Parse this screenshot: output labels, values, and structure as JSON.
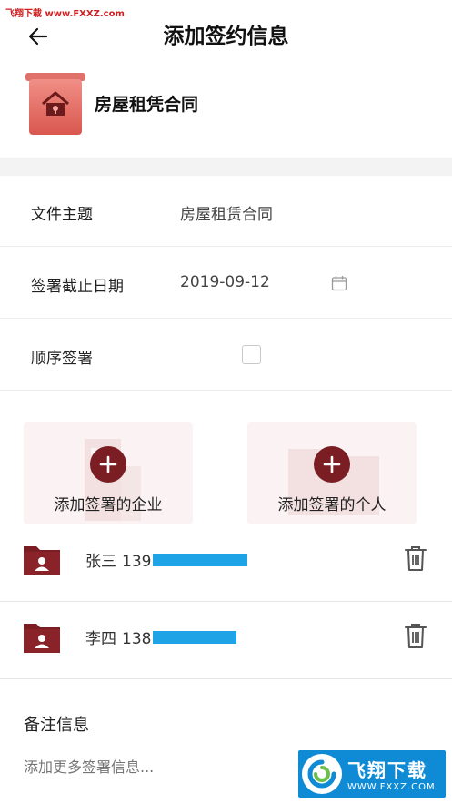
{
  "watermark_top": "飞翔下载 www.FXXZ.com",
  "header": {
    "title": "添加签约信息"
  },
  "document": {
    "name": "房屋租凭合同"
  },
  "form": {
    "subject": {
      "label": "文件主题",
      "value": "房屋租赁合同"
    },
    "deadline": {
      "label": "签署截止日期",
      "value": "2019-09-12"
    },
    "sequential": {
      "label": "顺序签署",
      "checked": false
    }
  },
  "add_actions": {
    "company": "添加签署的企业",
    "person": "添加签署的个人"
  },
  "signers": [
    {
      "name": "张三",
      "phone_prefix": "139"
    },
    {
      "name": "李四",
      "phone_prefix": "138"
    }
  ],
  "remarks": {
    "title": "备注信息",
    "placeholder": "添加更多签署信息..."
  },
  "watermark_logo": {
    "main": "飞翔下载",
    "url": "WWW.FXXZ.COM"
  },
  "colors": {
    "accent": "#7b1e24",
    "mask": "#1ea3e6",
    "watermark": "#0f8bd6"
  }
}
